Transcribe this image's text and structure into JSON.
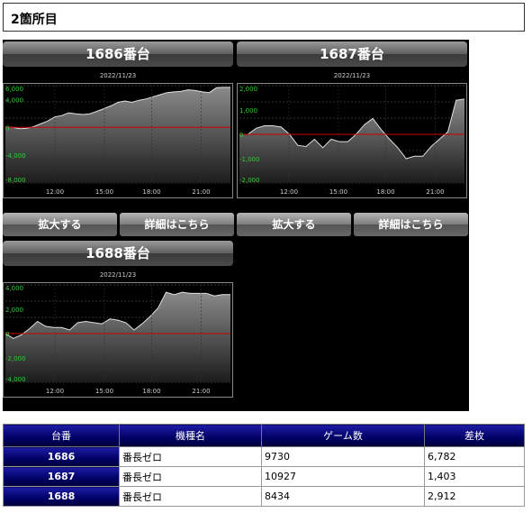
{
  "page": {
    "title": "2箇所目"
  },
  "machines": [
    {
      "id": "1686",
      "header": "1686番台",
      "date": "2022/11/23",
      "zoom_label": "拡大する",
      "detail_label": "詳細はこちら",
      "chart_data": {
        "type": "area",
        "x_ticks": [
          "12:00",
          "15:00",
          "18:00",
          "21:00"
        ],
        "y_ticks": [
          "6,000",
          "4,000",
          "0",
          "-4,000",
          "-8,000"
        ],
        "ylim": [
          -8000,
          6000
        ],
        "values": [
          0,
          0,
          -200,
          -150,
          100,
          500,
          900,
          1500,
          1700,
          2100,
          1950,
          1850,
          1950,
          2300,
          2700,
          3100,
          3600,
          3800,
          3600,
          3900,
          4100,
          4400,
          4700,
          5000,
          5100,
          5200,
          5400,
          5300,
          5100,
          5000,
          5700,
          5750,
          5750
        ]
      }
    },
    {
      "id": "1687",
      "header": "1687番台",
      "date": "2022/11/23",
      "zoom_label": "拡大する",
      "detail_label": "詳細はこちら",
      "chart_data": {
        "type": "area",
        "x_ticks": [
          "12:00",
          "15:00",
          "18:00",
          "21:00"
        ],
        "y_ticks": [
          "2,000",
          "1,000",
          "0",
          "-1,000",
          "-2,000"
        ],
        "ylim": [
          -2000,
          2000
        ],
        "values": [
          0,
          0,
          250,
          350,
          350,
          300,
          0,
          -450,
          -500,
          -200,
          -550,
          -200,
          -300,
          -300,
          0,
          400,
          650,
          200,
          -200,
          -550,
          -1000,
          -900,
          -900,
          -500,
          -200,
          100,
          1400,
          1450
        ]
      }
    },
    {
      "id": "1688",
      "header": "1688番台",
      "date": "2022/11/23",
      "zoom_label": "拡大する",
      "detail_label": "詳細はこちら",
      "chart_data": {
        "type": "area",
        "x_ticks": [
          "12:00",
          "15:00",
          "18:00",
          "21:00"
        ],
        "y_ticks": [
          "4,000",
          "2,000",
          "0",
          "-2,000",
          "-4,000"
        ],
        "ylim": [
          -4000,
          4000
        ],
        "values": [
          0,
          -400,
          -100,
          400,
          1000,
          600,
          500,
          500,
          300,
          900,
          1000,
          900,
          800,
          1200,
          1100,
          900,
          300,
          800,
          1400,
          2100,
          3400,
          3200,
          3400,
          3300,
          3300,
          3300,
          3100,
          3200,
          3200
        ]
      }
    }
  ],
  "table": {
    "headers": [
      "台番",
      "機種名",
      "ゲーム数",
      "差枚"
    ],
    "rows": [
      {
        "no": "1686",
        "name": "番長ゼロ",
        "games": "9730",
        "diff": "6,782"
      },
      {
        "no": "1687",
        "name": "番長ゼロ",
        "games": "10927",
        "diff": "1,403"
      },
      {
        "no": "1688",
        "name": "番長ゼロ",
        "games": "8434",
        "diff": "2,912"
      }
    ]
  },
  "colors": {
    "grid_zero": "#cc0000",
    "axis_label": "#33cc33",
    "header_blue": "#000080"
  }
}
